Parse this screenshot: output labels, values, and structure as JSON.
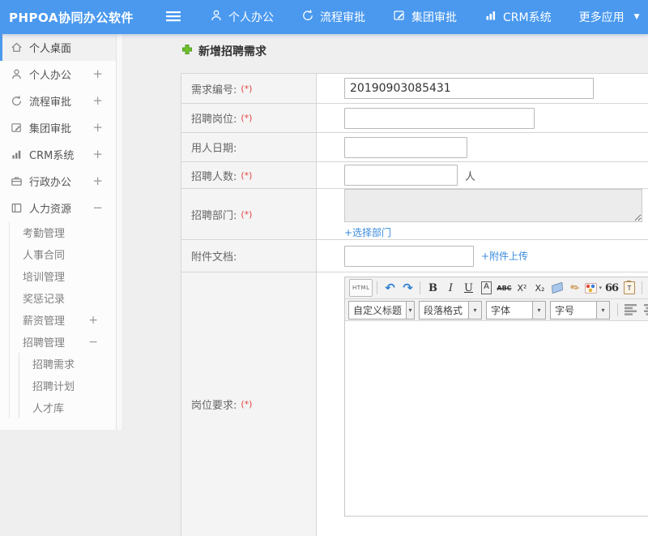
{
  "colors": {
    "accent": "#4a99ef",
    "link": "#3a8bdd",
    "required_red": "#e64545",
    "plus_green": "#72c02c"
  },
  "header": {
    "logo": "PHPOA协同办公软件",
    "menu": [
      {
        "label": "个人办公"
      },
      {
        "label": "流程审批"
      },
      {
        "label": "集团审批"
      },
      {
        "label": "CRM系统"
      },
      {
        "label": "更多应用",
        "caret": "▼"
      }
    ]
  },
  "sidebar": {
    "items": [
      {
        "label": "个人桌面",
        "active": true
      },
      {
        "label": "个人办公",
        "expander": "+"
      },
      {
        "label": "流程审批",
        "expander": "+"
      },
      {
        "label": "集团审批",
        "expander": "+"
      },
      {
        "label": "CRM系统",
        "expander": "+"
      },
      {
        "label": "行政办公",
        "expander": "+"
      },
      {
        "label": "人力资源",
        "expander": "−"
      }
    ],
    "hr_children": [
      {
        "label": "考勤管理"
      },
      {
        "label": "人事合同"
      },
      {
        "label": "培训管理"
      },
      {
        "label": "奖惩记录"
      },
      {
        "label": "薪资管理",
        "expander": "+"
      },
      {
        "label": "招聘管理",
        "expander": "−"
      }
    ],
    "recruit_children": [
      {
        "label": "招聘需求"
      },
      {
        "label": "招聘计划"
      },
      {
        "label": "人才库"
      }
    ]
  },
  "main": {
    "title": "新增招聘需求",
    "form": {
      "rows": [
        {
          "label": "需求编号:",
          "required": "(*)",
          "value": "20190903085431"
        },
        {
          "label": "招聘岗位:",
          "required": "(*)",
          "value": ""
        },
        {
          "label": "用人日期:",
          "value": ""
        },
        {
          "label": "招聘人数:",
          "required": "(*)",
          "value": "",
          "suffix": "人"
        },
        {
          "label": "招聘部门:",
          "required": "(*)",
          "link": "+选择部门"
        },
        {
          "label": "附件文档:",
          "value": "",
          "link": "+附件上传"
        },
        {
          "label": "岗位要求:",
          "required": "(*)"
        }
      ]
    },
    "editor": {
      "html_btn": "HTML",
      "bold": "B",
      "italic": "I",
      "underline": "U",
      "char_border": "A",
      "strike": "ABC",
      "sup": "X²",
      "sub": "X₂",
      "quote": "66",
      "font_color": "A",
      "caret": "▾",
      "selects": [
        {
          "label": "自定义标题"
        },
        {
          "label": "段落格式"
        },
        {
          "label": "字体"
        },
        {
          "label": "字号"
        }
      ]
    }
  }
}
